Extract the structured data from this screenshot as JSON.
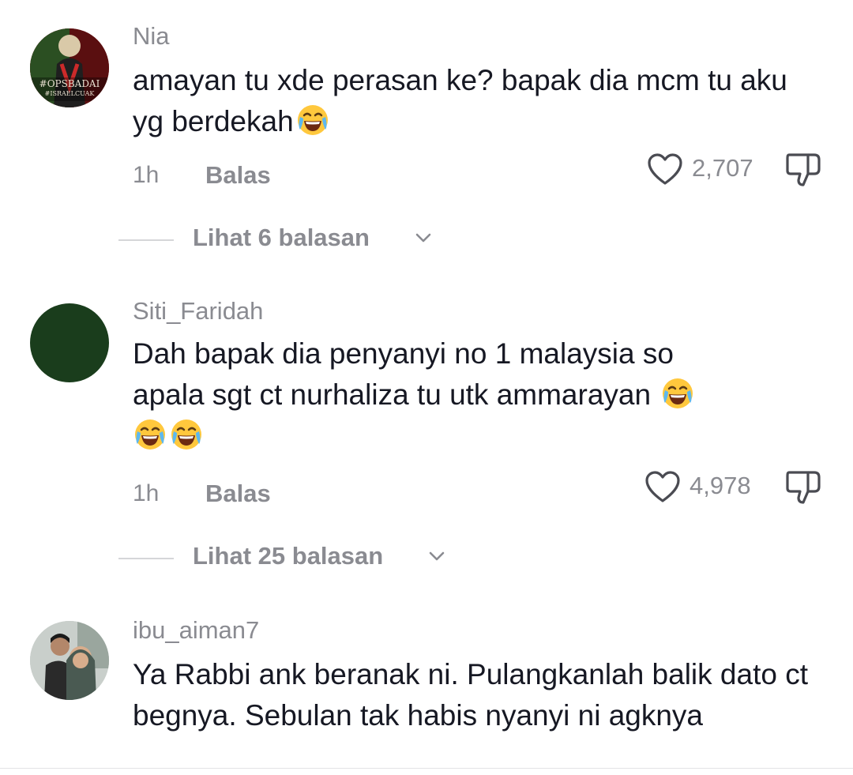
{
  "comments": [
    {
      "username": "Nia",
      "text": "amayan tu xde perasan ke? bapak dia mcm tu aku yg berdekah",
      "emoji_count": 1,
      "avatar_text_1": "#OPSBADAI",
      "avatar_text_2": "#ISRAELCUAK",
      "time": "1h",
      "reply_label": "Balas",
      "likes": "2,707",
      "replies_label": "Lihat 6 balasan"
    },
    {
      "username": "Siti_Faridah",
      "text_line1": "Dah bapak dia penyanyi no 1 malaysia so",
      "text_line2": "apala sgt ct nurhaliza tu utk ammarayan",
      "emoji_count": 3,
      "time": "1h",
      "reply_label": "Balas",
      "likes": "4,978",
      "replies_label": "Lihat 25 balasan"
    },
    {
      "username": "ibu_aiman7",
      "text": "Ya Rabbi ank beranak ni. Pulangkanlah balik dato ct begnya. Sebulan tak habis nyanyi ni agknya"
    }
  ],
  "icons": {
    "like": "heart-outline-icon",
    "dislike": "thumbs-down-outline-icon",
    "expand": "chevron-down-icon",
    "reaction": "laughing-tears-emoji"
  },
  "colors": {
    "text_primary": "#161823",
    "text_secondary": "#8a8b91",
    "divider": "#d5d6d9",
    "avatar2": "#1a3d1c"
  }
}
